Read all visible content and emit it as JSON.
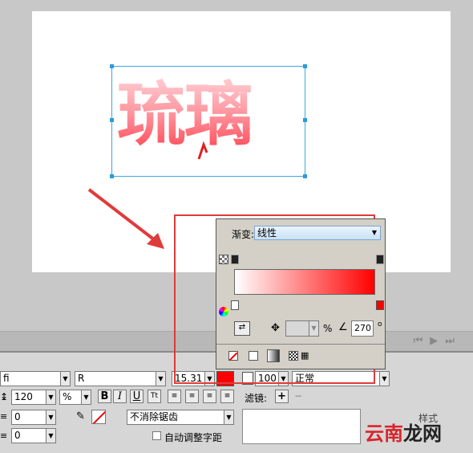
{
  "canvas": {
    "text": "琉璃"
  },
  "gradient_panel": {
    "type_label": "渐变:",
    "type_value": "线性",
    "percent_value": "",
    "percent_symbol": "%",
    "angle_value": "270",
    "start_color": "#ffffff",
    "end_color": "#ff0000"
  },
  "toolbar": {
    "font_value": "fi",
    "style_value": "R",
    "size_value": "15.31",
    "fill_color": "#ff0000",
    "opacity_value": "100",
    "blend_value": "正常",
    "filter_label": "滤镜:",
    "leading_value": "120",
    "percent_unit": "%",
    "bold": "B",
    "italic": "I",
    "underline": "U",
    "indent_value": "0",
    "spacing_value": "0",
    "antialias_value": "不消除锯齿",
    "autokern_label": "自动调整字距",
    "style_tab": "样式"
  },
  "watermark": {
    "prefix": "云南",
    "suffix": "龙网"
  },
  "colors": {
    "highlight": "#e03b3b",
    "selection": "#3ea7df"
  }
}
